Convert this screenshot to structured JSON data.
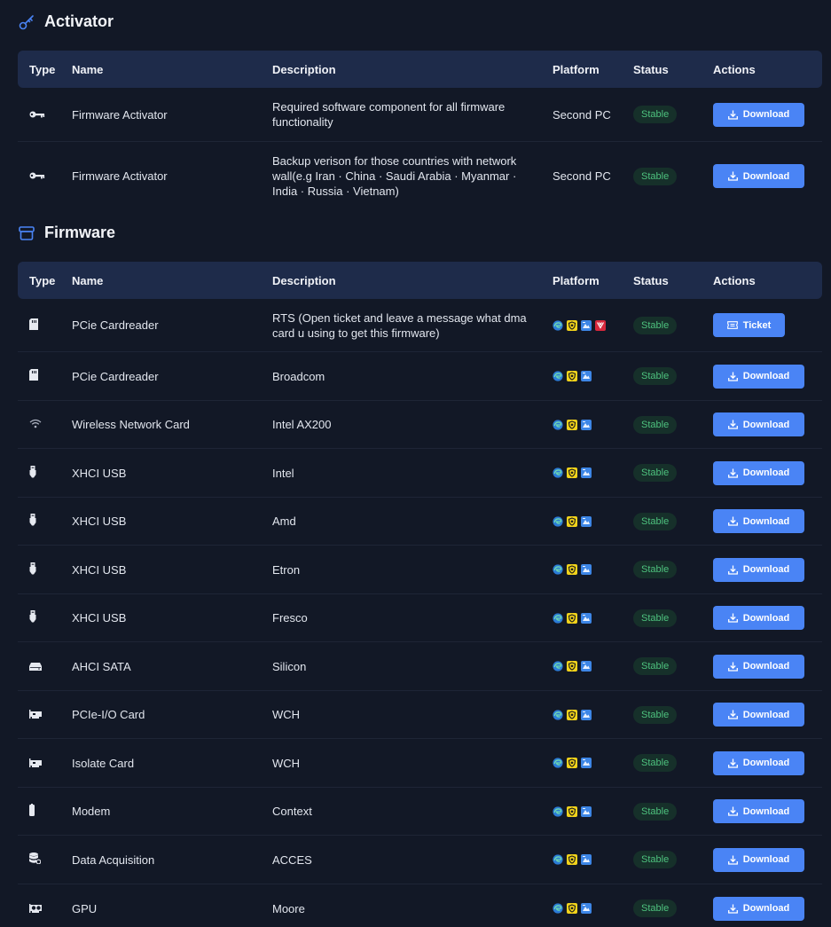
{
  "activator": {
    "title": "Activator",
    "headers": {
      "type": "Type",
      "name": "Name",
      "description": "Description",
      "platform": "Platform",
      "status": "Status",
      "actions": "Actions"
    },
    "rows": [
      {
        "icon": "key-icon",
        "name": "Firmware Activator",
        "description": "Required software component for all firmware functionality",
        "platform": "Second PC",
        "status": "Stable",
        "action": "Download"
      },
      {
        "icon": "key-icon",
        "name": "Firmware Activator",
        "description": "Backup verison for those countries with network wall(e.g Iran · China · Saudi Arabia · Myanmar · India · Russia · Vietnam)",
        "platform": "Second PC",
        "status": "Stable",
        "action": "Download"
      }
    ]
  },
  "firmware": {
    "title": "Firmware",
    "headers": {
      "type": "Type",
      "name": "Name",
      "description": "Description",
      "platform": "Platform",
      "status": "Status",
      "actions": "Actions"
    },
    "rows": [
      {
        "icon": "sd-card-icon",
        "name": "PCie Cardreader",
        "description": "RTS (Open ticket and leave a message what dma card u using to get this firmware)",
        "status": "Stable",
        "action": "Ticket"
      },
      {
        "icon": "sd-card-icon",
        "name": "PCie Cardreader",
        "description": "Broadcom",
        "status": "Stable",
        "action": "Download"
      },
      {
        "icon": "wifi-icon",
        "name": "Wireless Network Card",
        "description": "Intel AX200",
        "status": "Stable",
        "action": "Download"
      },
      {
        "icon": "usb-icon",
        "name": "XHCI USB",
        "description": "Intel",
        "status": "Stable",
        "action": "Download"
      },
      {
        "icon": "usb-icon",
        "name": "XHCI USB",
        "description": "Amd",
        "status": "Stable",
        "action": "Download"
      },
      {
        "icon": "usb-icon",
        "name": "XHCI USB",
        "description": "Etron",
        "status": "Stable",
        "action": "Download"
      },
      {
        "icon": "usb-icon",
        "name": "XHCI USB",
        "description": "Fresco",
        "status": "Stable",
        "action": "Download"
      },
      {
        "icon": "hard-drive-icon",
        "name": "AHCI SATA",
        "description": "Silicon",
        "status": "Stable",
        "action": "Download"
      },
      {
        "icon": "pcie-card-icon",
        "name": "PCIe-I/O Card",
        "description": "WCH",
        "status": "Stable",
        "action": "Download"
      },
      {
        "icon": "pcie-card-icon",
        "name": "Isolate Card",
        "description": "WCH",
        "status": "Stable",
        "action": "Download"
      },
      {
        "icon": "modem-icon",
        "name": "Modem",
        "description": "Context",
        "status": "Stable",
        "action": "Download"
      },
      {
        "icon": "database-icon",
        "name": "Data Acquisition",
        "description": "ACCES",
        "status": "Stable",
        "action": "Download"
      },
      {
        "icon": "gpu-icon",
        "name": "GPU",
        "description": "Moore",
        "status": "Stable",
        "action": "Download"
      }
    ]
  },
  "colors": {
    "accent": "#4a84f5",
    "stable_text": "#4ec27e",
    "stable_bg": "#16302a",
    "header_bg": "#1e2b4a",
    "page_bg": "#121826"
  }
}
